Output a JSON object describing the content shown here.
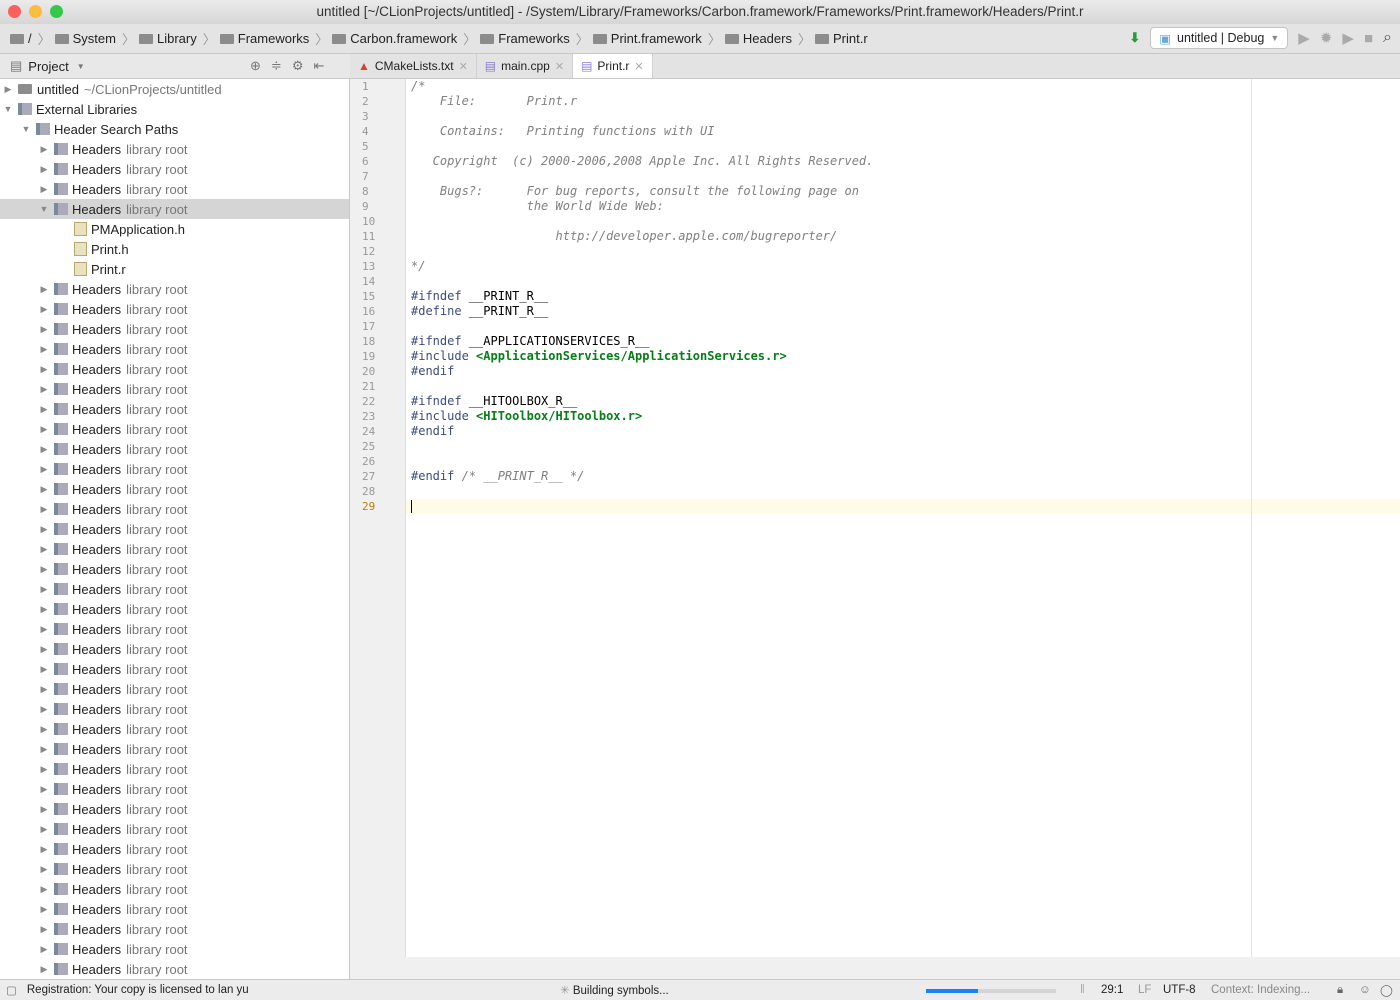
{
  "window": {
    "title": "untitled [~/CLionProjects/untitled] - /System/Library/Frameworks/Carbon.framework/Frameworks/Print.framework/Headers/Print.r"
  },
  "breadcrumbs": [
    "/",
    "System",
    "Library",
    "Frameworks",
    "Carbon.framework",
    "Frameworks",
    "Print.framework",
    "Headers",
    "Print.r"
  ],
  "toolbar": {
    "run_config": "untitled | Debug"
  },
  "project_panel": {
    "title": "Project"
  },
  "tabs": [
    {
      "label": "CMakeLists.txt",
      "active": false
    },
    {
      "label": "main.cpp",
      "active": false
    },
    {
      "label": "Print.r",
      "active": true
    }
  ],
  "tree": {
    "root": {
      "label": "untitled",
      "suffix": "~/CLionProjects/untitled"
    },
    "external": {
      "label": "External Libraries"
    },
    "hsp": {
      "label": "Header Search Paths"
    },
    "header_label": "Headers",
    "header_suffix": "library root",
    "headers_before": 3,
    "selected_index": 3,
    "files": [
      "PMApplication.h",
      "Print.h",
      "Print.r"
    ],
    "headers_after": 35
  },
  "code": [
    [
      [
        "cm",
        "/*"
      ]
    ],
    [
      [
        "cm",
        "    File:       Print.r"
      ]
    ],
    [],
    [
      [
        "cm",
        "    Contains:   Printing functions with UI"
      ]
    ],
    [],
    [
      [
        "cm",
        "   Copyright  (c) 2000-2006,2008 Apple Inc. All Rights Reserved."
      ]
    ],
    [],
    [
      [
        "cm",
        "    Bugs?:      For bug reports, consult the following page on"
      ]
    ],
    [
      [
        "cm",
        "                the World Wide Web:"
      ]
    ],
    [],
    [
      [
        "cm",
        "                    http://developer.apple.com/bugreporter/"
      ]
    ],
    [],
    [
      [
        "cm",
        "*/"
      ]
    ],
    [],
    [
      [
        "kw",
        "#ifndef "
      ],
      [
        "plain",
        "__PRINT_R__"
      ]
    ],
    [
      [
        "kw",
        "#define "
      ],
      [
        "plain",
        "__PRINT_R__"
      ]
    ],
    [],
    [
      [
        "kw",
        "#ifndef "
      ],
      [
        "plain",
        "__APPLICATIONSERVICES_R__"
      ]
    ],
    [
      [
        "kw",
        "#include "
      ],
      [
        "str",
        "<ApplicationServices/ApplicationServices.r>"
      ]
    ],
    [
      [
        "kw",
        "#endif"
      ]
    ],
    [],
    [
      [
        "kw",
        "#ifndef "
      ],
      [
        "plain",
        "__HITOOLBOX_R__"
      ]
    ],
    [
      [
        "kw",
        "#include "
      ],
      [
        "str",
        "<HIToolbox/HIToolbox.r>"
      ]
    ],
    [
      [
        "kw",
        "#endif"
      ]
    ],
    [],
    [],
    [
      [
        "kw",
        "#endif "
      ],
      [
        "cm",
        "/* __PRINT_R__ */"
      ]
    ],
    [],
    []
  ],
  "status": {
    "message": "Registration: Your copy is licensed to lan yu",
    "task": "Building symbols...",
    "progress": 0.4,
    "position": "29:1",
    "line_sep": "LF",
    "encoding": "UTF-8",
    "context": "Context: Indexing..."
  }
}
